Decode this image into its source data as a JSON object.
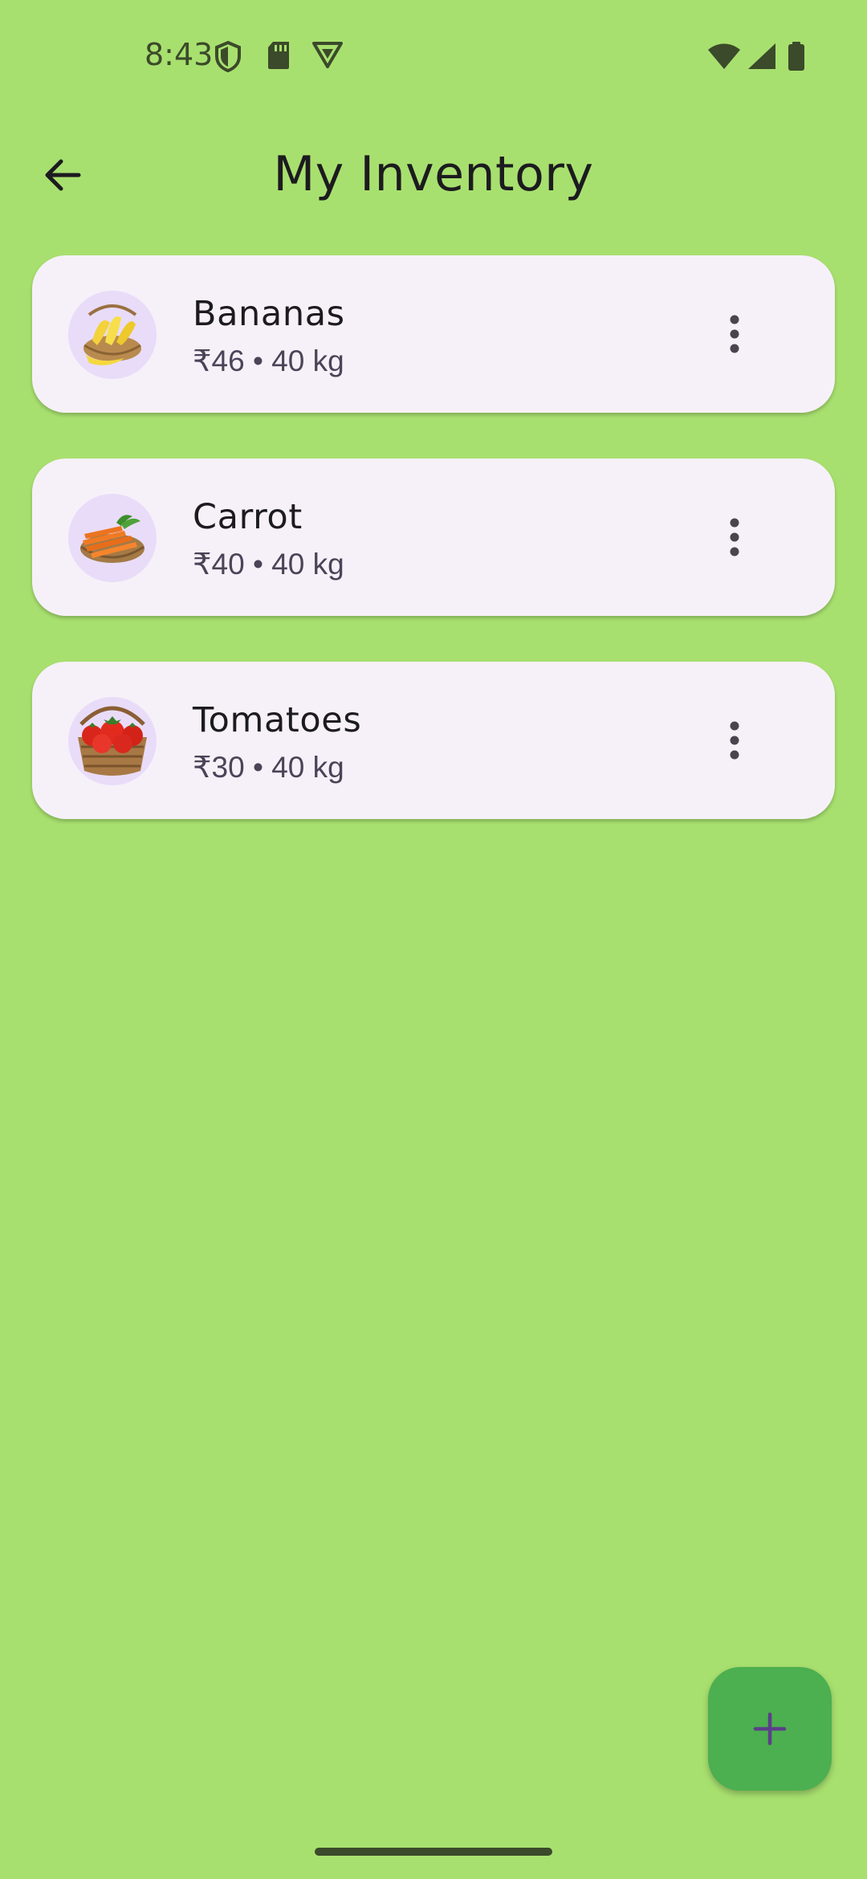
{
  "status_bar": {
    "time": "8:43",
    "left_icons": [
      "shield-icon",
      "sd-card-icon",
      "vpn-badge-icon"
    ],
    "right_icons": [
      "wifi-icon",
      "signal-icon",
      "battery-icon"
    ]
  },
  "app_bar": {
    "title": "My Inventory",
    "back_icon": "arrow-left-icon"
  },
  "inventory": {
    "items": [
      {
        "name": "Bananas",
        "meta": "₹46 • 40 kg",
        "image": "banana-basket"
      },
      {
        "name": "Carrot",
        "meta": "₹40 • 40 kg",
        "image": "carrot-basket"
      },
      {
        "name": "Tomatoes",
        "meta": "₹30 • 40 kg",
        "image": "tomato-basket"
      }
    ],
    "more_icon": "more-vert-icon"
  },
  "fab": {
    "icon": "plus-icon"
  },
  "colors": {
    "background": "#a8e06f",
    "card": "#f6f1f8",
    "thumb_bg": "#e9dcf9",
    "fab": "#4caf50",
    "fab_icon": "#5b3f8a",
    "status_icons": "#3b4a2a"
  }
}
